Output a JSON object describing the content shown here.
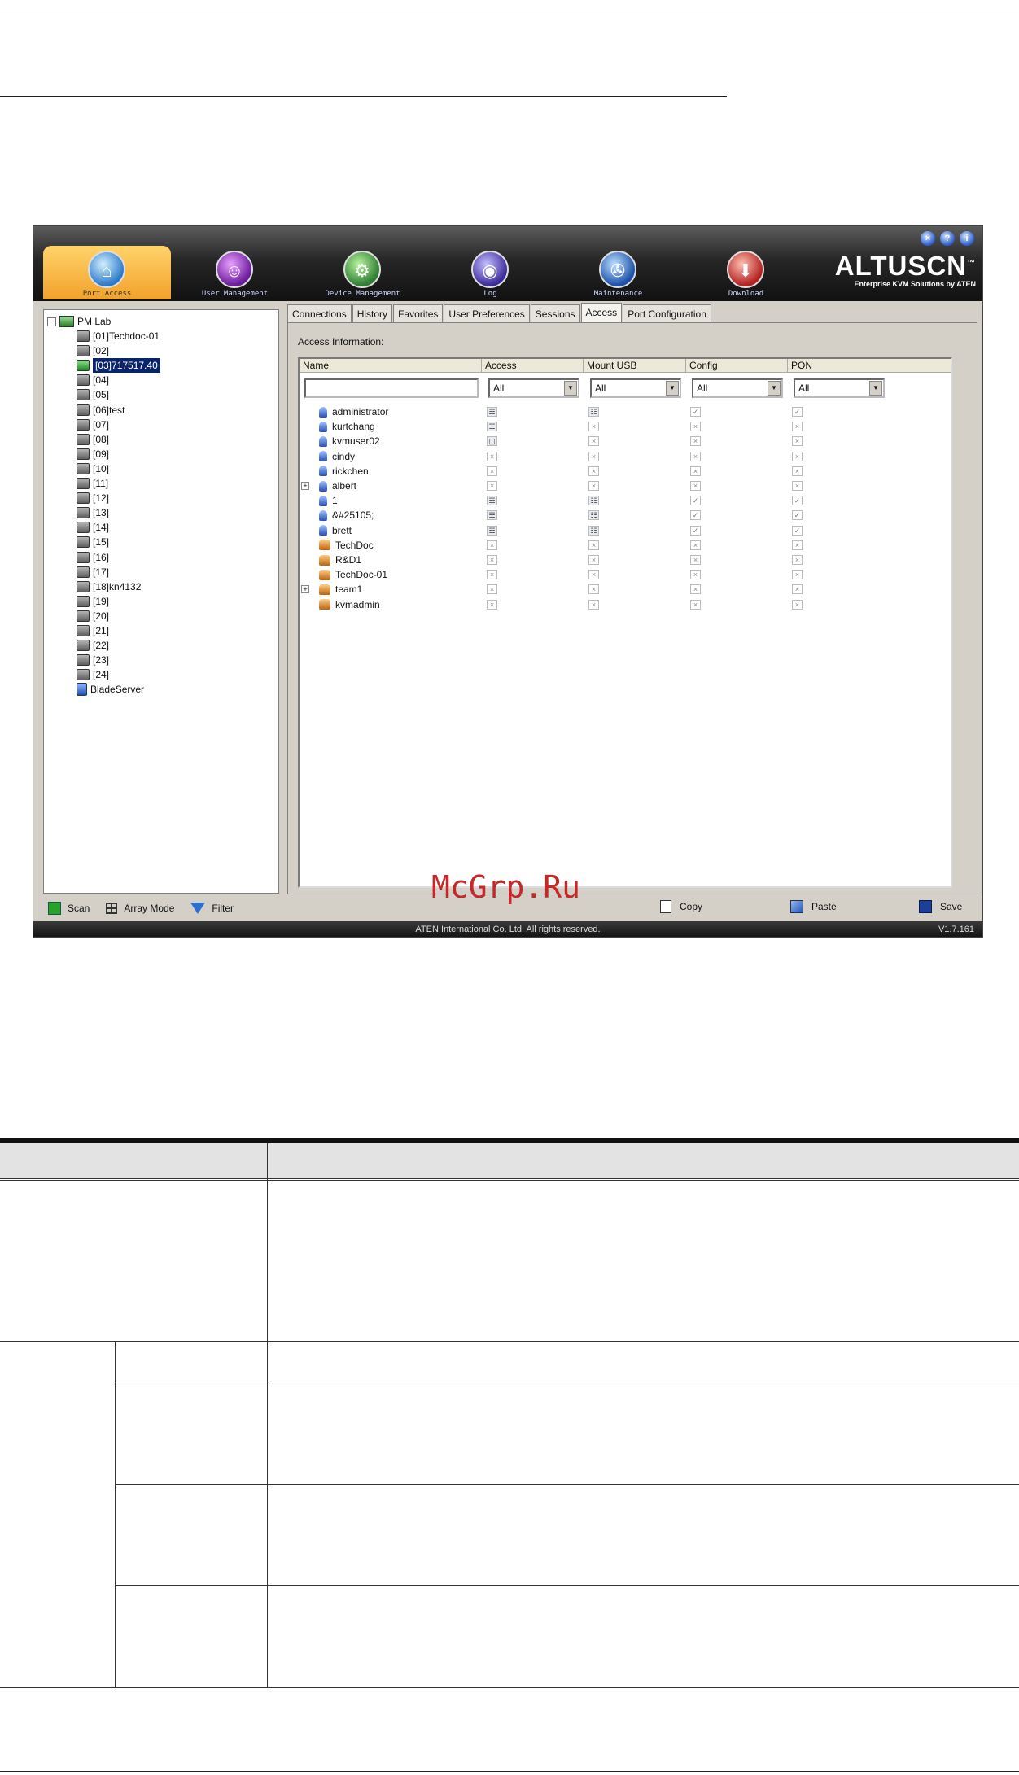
{
  "app": {
    "window_buttons": [
      "×",
      "?",
      "i"
    ],
    "nav_tabs": [
      {
        "label": "Port Access",
        "glyph": "⌂",
        "active": true
      },
      {
        "label": "User Management",
        "glyph": "☺",
        "active": false
      },
      {
        "label": "Device Management",
        "glyph": "⚙",
        "active": false
      },
      {
        "label": "Log",
        "glyph": "◉",
        "active": false
      },
      {
        "label": "Maintenance",
        "glyph": "✇",
        "active": false
      },
      {
        "label": "Download",
        "glyph": "⬇",
        "active": false
      }
    ],
    "brand": {
      "name": "ALTUSCN",
      "tm": "™",
      "tagline": "Enterprise KVM Solutions by ATEN"
    },
    "tree": {
      "root": "PM Lab",
      "items": [
        "[01]Techdoc-01",
        "[02]",
        "[03]717517.40",
        "[04]",
        "[05]",
        "[06]test",
        "[07]",
        "[08]",
        "[09]",
        "[10]",
        "[11]",
        "[12]",
        "[13]",
        "[14]",
        "[15]",
        "[16]",
        "[17]",
        "[18]kn4132",
        "[19]",
        "[20]",
        "[21]",
        "[22]",
        "[23]",
        "[24]",
        "BladeServer"
      ],
      "selected_index": 2
    },
    "tree_footer": {
      "scan": "Scan",
      "array_mode": "Array Mode",
      "filter": "Filter"
    },
    "tabs": [
      "Connections",
      "History",
      "Favorites",
      "User Preferences",
      "Sessions",
      "Access",
      "Port Configuration"
    ],
    "active_tab": "Access",
    "access_info_label": "Access Information:",
    "columns": [
      "Name",
      "Access",
      "Mount USB",
      "Config",
      "PON"
    ],
    "filters": {
      "name_placeholder": "",
      "access": "All",
      "mount_usb": "All",
      "config": "All",
      "pon": "All"
    },
    "rows": [
      {
        "name": "administrator",
        "type": "user",
        "expand": false,
        "access": "full",
        "usb": "full",
        "config": "check",
        "pon": "check"
      },
      {
        "name": "kurtchang",
        "type": "user",
        "expand": false,
        "access": "full",
        "usb": "x",
        "config": "x",
        "pon": "x"
      },
      {
        "name": "kvmuser02",
        "type": "user",
        "expand": false,
        "access": "view",
        "usb": "x",
        "config": "x",
        "pon": "x"
      },
      {
        "name": "cindy",
        "type": "user",
        "expand": false,
        "access": "x",
        "usb": "x",
        "config": "x",
        "pon": "x"
      },
      {
        "name": "rickchen",
        "type": "user",
        "expand": false,
        "access": "x",
        "usb": "x",
        "config": "x",
        "pon": "x"
      },
      {
        "name": "albert",
        "type": "user",
        "expand": true,
        "access": "x",
        "usb": "x",
        "config": "x",
        "pon": "x"
      },
      {
        "name": "1",
        "type": "user",
        "expand": false,
        "access": "full",
        "usb": "full",
        "config": "check",
        "pon": "check"
      },
      {
        "name": "&#25105;",
        "type": "user",
        "expand": false,
        "access": "full",
        "usb": "full",
        "config": "check",
        "pon": "check"
      },
      {
        "name": "brett",
        "type": "user",
        "expand": false,
        "access": "full",
        "usb": "full",
        "config": "check",
        "pon": "check"
      },
      {
        "name": "TechDoc",
        "type": "group",
        "expand": false,
        "access": "x",
        "usb": "x",
        "config": "x",
        "pon": "x"
      },
      {
        "name": "R&D1",
        "type": "group",
        "expand": false,
        "access": "x",
        "usb": "x",
        "config": "x",
        "pon": "x"
      },
      {
        "name": "TechDoc-01",
        "type": "group",
        "expand": false,
        "access": "x",
        "usb": "x",
        "config": "x",
        "pon": "x"
      },
      {
        "name": "team1",
        "type": "group",
        "expand": true,
        "access": "x",
        "usb": "x",
        "config": "x",
        "pon": "x"
      },
      {
        "name": "kvmadmin",
        "type": "group",
        "expand": false,
        "access": "x",
        "usb": "x",
        "config": "x",
        "pon": "x"
      }
    ],
    "perm_glyphs": {
      "full": "☷",
      "view": "◫",
      "x": "×",
      "check": "✓"
    },
    "actions": {
      "copy": "Copy",
      "paste": "Paste",
      "save": "Save"
    },
    "status": {
      "copyright": "ATEN International Co. Ltd. All rights reserved.",
      "version": "V1.7.161"
    }
  },
  "watermark": "McGrp.Ru",
  "colors": {
    "active_tab": "#f2a12b",
    "selection": "#0a246a",
    "watermark": "#c62828"
  }
}
